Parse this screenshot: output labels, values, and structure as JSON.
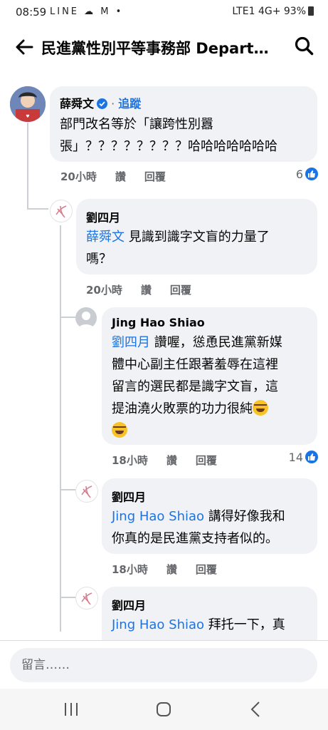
{
  "status": {
    "time": "08:59",
    "left_icons": "LINE ☁ M •",
    "right_text": "LTE1 4G+ 93%"
  },
  "header": {
    "title": "民進黨性別平等事務部 Departme…"
  },
  "comments": [
    {
      "author": "薛舜文",
      "follow_label": "追蹤",
      "text_line1": "部門改名等於「讓跨性別囂",
      "text_line2": "張」？？？？？？？？哈哈哈哈哈哈哈",
      "time": "20小時",
      "like_label": "讚",
      "reply_label": "回覆",
      "like_count": "6"
    },
    {
      "author": "劉四月",
      "mention": "薛舜文",
      "text_line1": " 見識到識字文盲的力量了",
      "text_line2": "嗎？",
      "time": "20小時",
      "like_label": "讚",
      "reply_label": "回覆"
    },
    {
      "author": "Jing Hao Shiao",
      "mention": "劉四月",
      "text_line1": " 讚喔，慫恿民進黨新媒",
      "text_line2": "體中心副主任跟著羞辱在這裡",
      "text_line3": "留言的選民都是識字文盲，這",
      "text_line4": "提油澆火敗票的功力很純",
      "time": "18小時",
      "like_label": "讚",
      "reply_label": "回覆",
      "like_count": "14"
    },
    {
      "author": "劉四月",
      "mention": "Jing Hao Shiao",
      "text_line1": " 講得好像我和",
      "text_line2": "你真的是民進黨支持者似的。",
      "time": "18小時",
      "like_label": "讚",
      "reply_label": "回覆"
    },
    {
      "author": "劉四月",
      "mention": "Jing Hao Shiao",
      "text_line1": " 拜托一下，真"
    }
  ],
  "composer": {
    "placeholder": "留言……"
  }
}
